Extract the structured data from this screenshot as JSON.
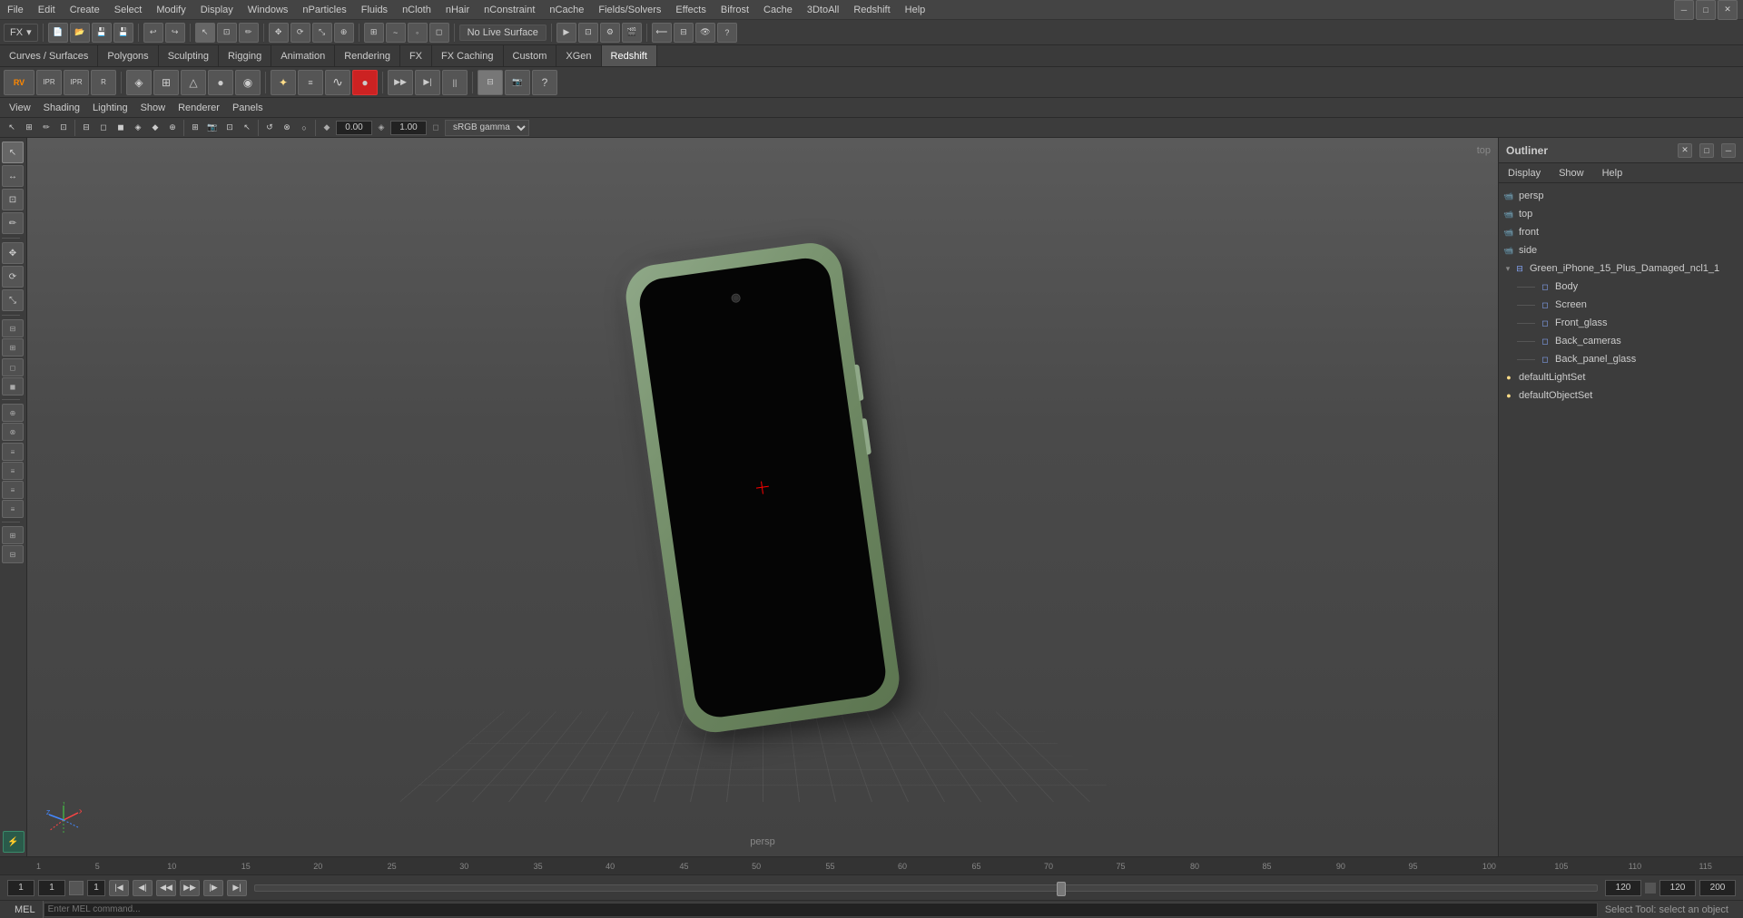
{
  "menubar": {
    "items": [
      "File",
      "Edit",
      "Create",
      "Select",
      "Modify",
      "Display",
      "Windows",
      "nParticles",
      "Fluids",
      "nCloth",
      "nHair",
      "nConstraint",
      "nCache",
      "Fields/Solvers",
      "Effects",
      "Bifrost",
      "Cache",
      "3DtoAll",
      "Redshift",
      "Help"
    ]
  },
  "toolbar1": {
    "label": "FX",
    "live_surface": "No Live Surface"
  },
  "shelf": {
    "tabs": [
      "Curves / Surfaces",
      "Polygons",
      "Sculpting",
      "Rigging",
      "Animation",
      "Rendering",
      "FX",
      "FX Caching",
      "Custom",
      "XGen",
      "Redshift"
    ],
    "active_tab": "Redshift"
  },
  "viewport_menu": {
    "items": [
      "View",
      "Shading",
      "Lighting",
      "Show",
      "Renderer",
      "Panels"
    ]
  },
  "viewport": {
    "label": "persp",
    "color_value": "0.00",
    "gamma_value": "1.00",
    "color_space": "sRGB gamma"
  },
  "outliner": {
    "title": "Outliner",
    "menu": [
      "Display",
      "Show",
      "Help"
    ],
    "items": [
      {
        "label": "persp",
        "type": "camera",
        "indent": 0
      },
      {
        "label": "top",
        "type": "camera",
        "indent": 0
      },
      {
        "label": "front",
        "type": "camera",
        "indent": 0
      },
      {
        "label": "side",
        "type": "camera",
        "indent": 0
      },
      {
        "label": "Green_iPhone_15_Plus_Damaged_ncl1_1",
        "type": "group",
        "indent": 0,
        "expanded": true
      },
      {
        "label": "Body",
        "type": "mesh",
        "indent": 1
      },
      {
        "label": "Screen",
        "type": "mesh",
        "indent": 1
      },
      {
        "label": "Front_glass",
        "type": "mesh",
        "indent": 1
      },
      {
        "label": "Back_cameras",
        "type": "mesh",
        "indent": 1
      },
      {
        "label": "Back_panel_glass",
        "type": "mesh",
        "indent": 1
      },
      {
        "label": "defaultLightSet",
        "type": "set",
        "indent": 0
      },
      {
        "label": "defaultObjectSet",
        "type": "set",
        "indent": 0
      }
    ]
  },
  "timeline": {
    "current_frame": "1",
    "start_frame": "1",
    "end_frame": "200",
    "playhead_frame": "120",
    "range_end": "120",
    "ticks": [
      "1",
      "5",
      "10",
      "15",
      "20",
      "25",
      "30",
      "35",
      "40",
      "45",
      "50",
      "55",
      "60",
      "65",
      "70",
      "75",
      "80",
      "85",
      "90",
      "95",
      "100",
      "105",
      "110",
      "115"
    ]
  },
  "statusbar": {
    "mel_label": "MEL",
    "status_text": "Select Tool: select an object"
  },
  "left_tools": {
    "buttons": [
      "▶",
      "↔",
      "↕",
      "⟲",
      "■",
      "◆",
      "○",
      "△",
      "□",
      "⊕",
      "⊗",
      "✦",
      "⟳",
      "⊞"
    ]
  },
  "icons": {
    "camera": "📷",
    "mesh": "◻",
    "group": "▸",
    "set": "●",
    "collapse_open": "▾",
    "collapse_closed": "▸"
  }
}
